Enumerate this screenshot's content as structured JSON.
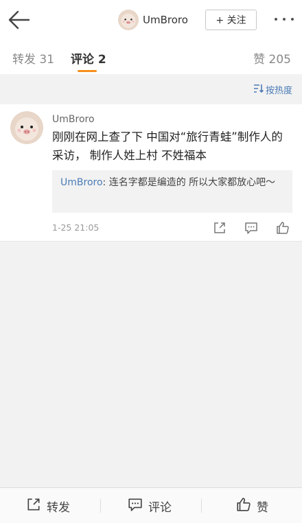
{
  "header": {
    "username": "UmBroro",
    "follow_label": "+ 关注"
  },
  "tabs": {
    "repost_label": "转发 31",
    "comment_label": "评论 2",
    "like_label": "赞 205"
  },
  "sort": {
    "label": "按热度"
  },
  "comment": {
    "username": "UmBroro",
    "text": "刚刚在网上查了下 中国对“旅行青蛙”制作人的采访， 制作人姓上村  不姓福本",
    "reply": {
      "username": "UmBroro",
      "separator": ": ",
      "text": "连名字都是编造的 所以大家都放心吧～"
    },
    "time": "1-25 21:05"
  },
  "bottom_bar": {
    "repost_label": "转发",
    "comment_label": "评论",
    "like_label": "赞"
  },
  "colors": {
    "accent": "#f78e1d",
    "link": "#4a7bb6"
  }
}
